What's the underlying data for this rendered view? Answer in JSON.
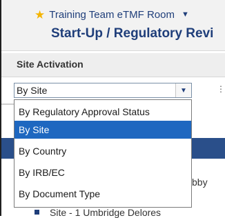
{
  "header": {
    "room_name": "Training Team eTMF Room",
    "page_title": "Start-Up / Regulatory Revi"
  },
  "panel": {
    "title": "Site Activation"
  },
  "group_select": {
    "value": "By Site",
    "options": [
      "By Regulatory Approval Status",
      "By Site",
      "By Country",
      "By IRB/EC",
      "By Document Type"
    ],
    "selected_index": 1
  },
  "background": {
    "partial_text_right": "bby",
    "partial_site_row": "Site - 1 Umbridge Delores"
  },
  "colors": {
    "brand_blue": "#1f3e7a",
    "selection_blue": "#1e67c0",
    "star": "#f4b400"
  }
}
